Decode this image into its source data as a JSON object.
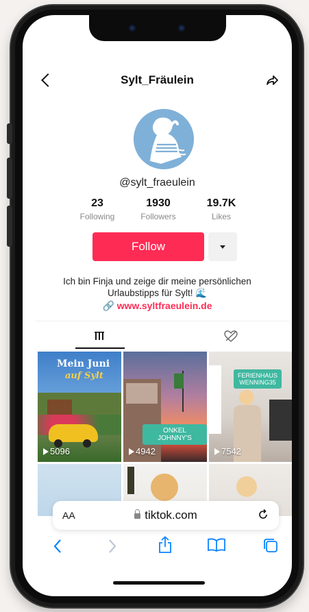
{
  "header": {
    "title": "Sylt_Fräulein"
  },
  "profile": {
    "username": "@sylt_fraeulein",
    "stats": [
      {
        "value": "23",
        "label": "Following"
      },
      {
        "value": "1930",
        "label": "Followers"
      },
      {
        "value": "19.7K",
        "label": "Likes"
      }
    ],
    "follow_label": "Follow",
    "bio_line1": "Ich bin Finja und zeige dir meine persönlichen",
    "bio_line2": "Urlaubstipps für Sylt! 🌊",
    "link": "www.syltfraeulein.de"
  },
  "videos": [
    {
      "views": "5096",
      "title_line1": "Mein Juni",
      "title_line2": "auf Sylt"
    },
    {
      "views": "4942",
      "tag": "ONKEL JOHNNY'S"
    },
    {
      "views": "7542",
      "tag_line1": "FERIENHAUS",
      "tag_line2": "WENNING35"
    }
  ],
  "browser": {
    "aa_label": "AA",
    "url": "tiktok.com"
  },
  "colors": {
    "accent": "#fe2c55",
    "link_blue": "#0a84ff"
  }
}
